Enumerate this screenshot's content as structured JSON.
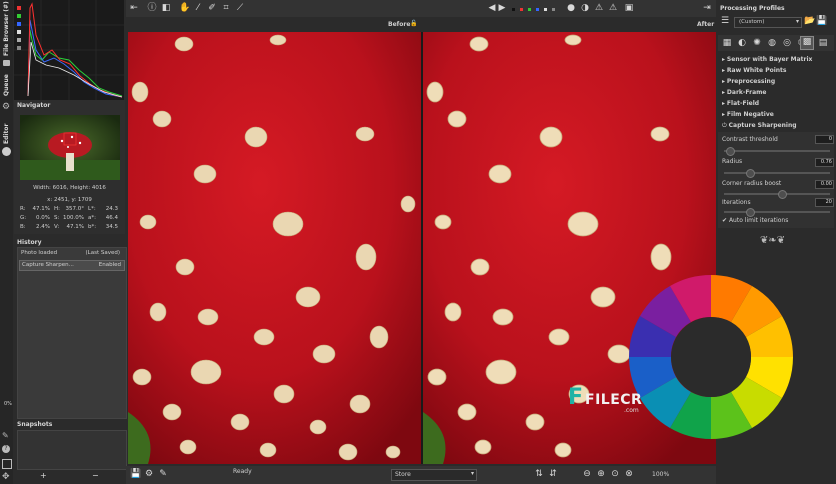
{
  "left_tabs": {
    "file_browser": "File Browser (#)",
    "queue": "Queue",
    "editor": "Editor"
  },
  "navigator": {
    "title": "Navigator",
    "size_info": "Width: 6016, Height: 4016",
    "coords": "x: 2451, y: 1709",
    "readout": [
      [
        "R:",
        "47.1%",
        "H:",
        "357.0°",
        "L*:",
        "24.3"
      ],
      [
        "G:",
        "0.0%",
        "S:",
        "100.0%",
        "a*:",
        "46.4"
      ],
      [
        "B:",
        "2.4%",
        "V:",
        "47.1%",
        "b*:",
        "34.5"
      ]
    ]
  },
  "history": {
    "title": "History",
    "items": [
      {
        "label": "Photo loaded",
        "value": "(Last Saved)"
      },
      {
        "label": "Capture Sharpen...",
        "value": "Enabled"
      }
    ]
  },
  "snapshots": {
    "title": "Snapshots",
    "add": "+",
    "remove": "−"
  },
  "side_percent": "0%",
  "preview": {
    "before": "Before",
    "after": "After"
  },
  "status": {
    "ready": "Ready",
    "store": "Store",
    "zoom": "100%"
  },
  "profiles": {
    "title": "Processing Profiles",
    "selected": "(Custom)"
  },
  "tools": [
    {
      "label": "Sensor with Bayer Matrix"
    },
    {
      "label": "Raw White Points"
    },
    {
      "label": "Preprocessing"
    },
    {
      "label": "Dark-Frame"
    },
    {
      "label": "Flat-Field"
    },
    {
      "label": "Film Negative"
    },
    {
      "label": "Capture Sharpening"
    }
  ],
  "sharpening": {
    "contrast": {
      "label": "Contrast threshold",
      "value": "0"
    },
    "radius": {
      "label": "Radius",
      "value": "0.76"
    },
    "corner": {
      "label": "Corner radius boost",
      "value": "0.00"
    },
    "iterations": {
      "label": "Iterations",
      "value": "20"
    },
    "auto_limit": "Auto limit iterations"
  },
  "watermark": {
    "brand": "FILECR",
    "tld": ".com"
  },
  "colors": {
    "accent_red": "#c71521",
    "wheel_center": "#2b2b2b"
  }
}
